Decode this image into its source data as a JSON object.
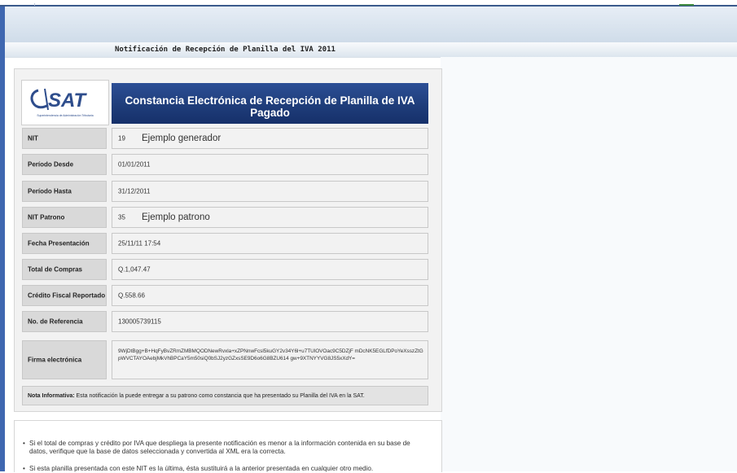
{
  "page_title": "Notificación de Recepción de Planilla del IVA 2011",
  "logo": {
    "text": "SAT",
    "subtitle": "Superintendencia de Administración Tributaria"
  },
  "header": {
    "title": "Constancia Electrónica de Recepción de Planilla de IVA Pagado"
  },
  "rows": [
    {
      "label": "NIT",
      "value": "19",
      "extra": "Ejemplo generador"
    },
    {
      "label": "Período Desde",
      "value": "01/01/2011",
      "extra": ""
    },
    {
      "label": "Período Hasta",
      "value": "31/12/2011",
      "extra": ""
    },
    {
      "label": "NIT Patrono",
      "value": "35",
      "extra": "Ejemplo patrono"
    },
    {
      "label": "Fecha Presentación",
      "value": "25/11/11 17:54",
      "extra": ""
    },
    {
      "label": "Total de Compras",
      "value": "Q.1,047.47",
      "extra": ""
    },
    {
      "label": "Crédito Fiscal Reportado",
      "value": "Q.558.66",
      "extra": ""
    },
    {
      "label": "No. de Referencia",
      "value": "130005739115",
      "extra": ""
    }
  ],
  "firma": {
    "label": "Firma electrónica",
    "value": "9WjDtBgg+B+HqFyBvZRmZMBMQODNewRvxla+xZPNnwFcsl5kuGY2v34Y6l+u7TUlOVOac9C5DZjF mDcNK5EGLfDPoYeXsszZtGpWVCTAYOAebjMkVhBPCaY5m50siQ0bSJ2yzGZxsSE9D6o6G8BZU614 gw+9XTNYYVG8JS5xXdY="
  },
  "note": {
    "bold": "Nota Informativa:",
    "text": " Esta notificación la puede entregar a su patrono como constancia que ha presentado su Planilla del IVA en la SAT."
  },
  "bullets": [
    "Si el total de compras y crédito por IVA que despliega la presente notificación es menor a la información contenida en su base de datos, verifique que la base de datos seleccionada y convertida al XML era la correcta.",
    "Si esta planilla presentada con este NIT es la última, ésta sustituirá a la anterior presentada en cualquier otro medio."
  ],
  "colors": {
    "banner": "#1f3d7a",
    "label_bg": "#d9d9d9",
    "value_bg": "#f2f2f2"
  }
}
